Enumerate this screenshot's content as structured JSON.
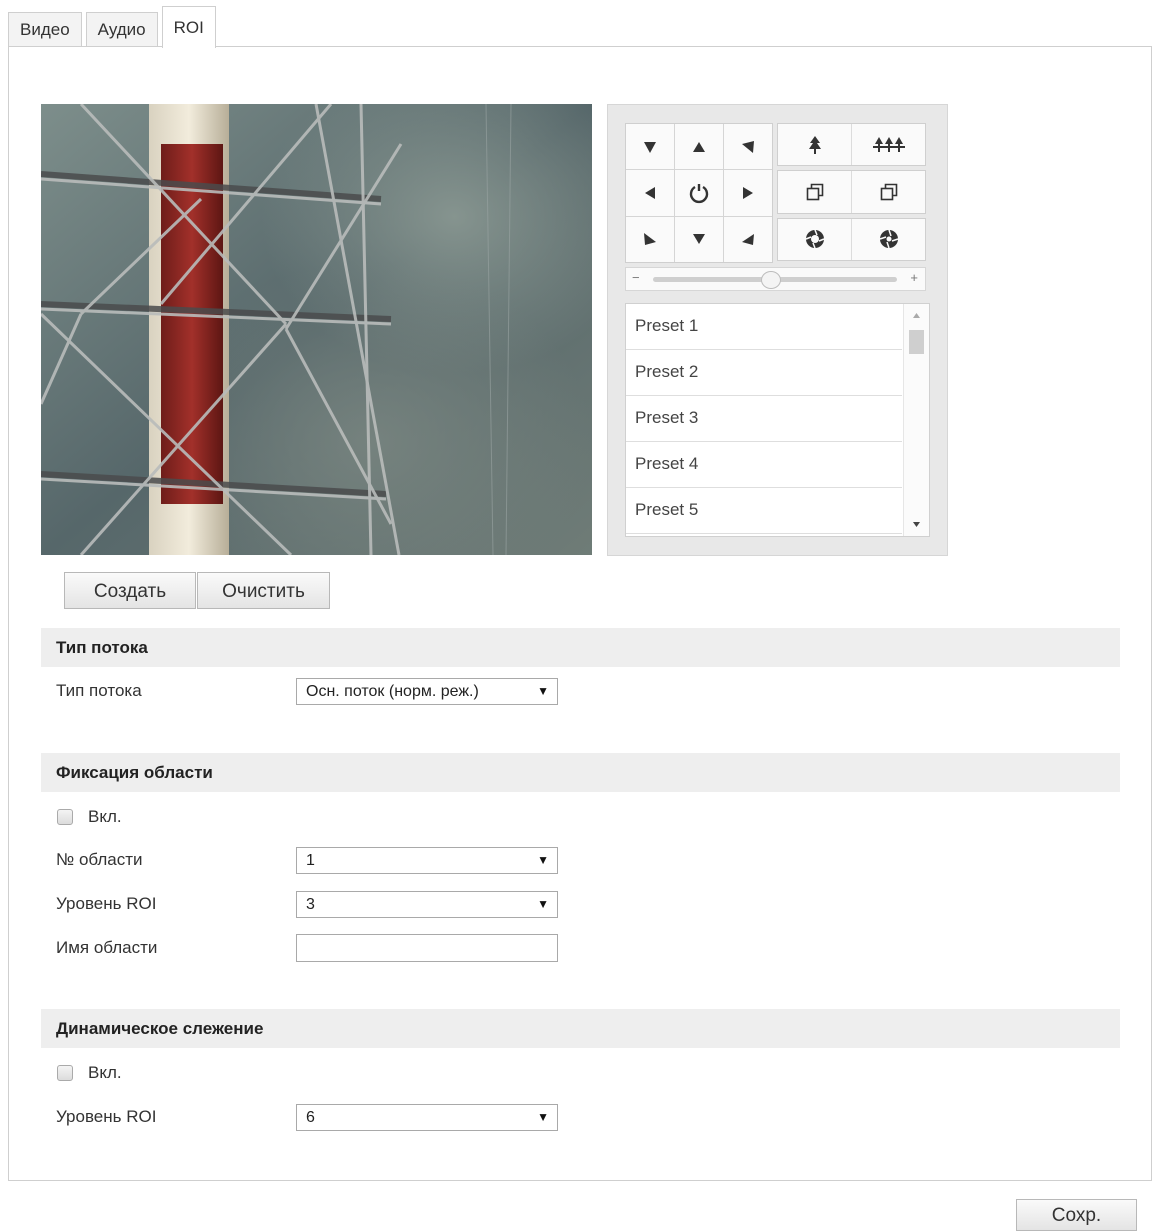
{
  "tabs": [
    {
      "label": "Видео",
      "active": false
    },
    {
      "label": "Аудио",
      "active": false
    },
    {
      "label": "ROI",
      "active": true
    }
  ],
  "ptz": {
    "presets": [
      "Preset 1",
      "Preset 2",
      "Preset 3",
      "Preset 4",
      "Preset 5"
    ],
    "slider_minus": "−",
    "slider_plus": "+",
    "slider_level": 0.48
  },
  "buttons": {
    "create": "Создать",
    "clear": "Очистить",
    "save": "Сохр."
  },
  "stream_section": {
    "title": "Тип потока",
    "stream_type_label": "Тип потока",
    "stream_type_value": "Осн. поток (норм. реж.)"
  },
  "fixed_region": {
    "title": "Фиксация области",
    "enable_label": "Вкл.",
    "enabled": false,
    "region_no_label": "№ области",
    "region_no_value": "1",
    "roi_level_label": "Уровень ROI",
    "roi_level_value": "3",
    "region_name_label": "Имя области",
    "region_name_value": ""
  },
  "dynamic_tracking": {
    "title": "Динамическое слежение",
    "enable_label": "Вкл.",
    "enabled": false,
    "roi_level_label": "Уровень ROI",
    "roi_level_value": "6"
  },
  "colors": {
    "section_bg": "#eeeeee",
    "border": "#cfcfcf",
    "ptz_bg": "#e8e8e8"
  }
}
